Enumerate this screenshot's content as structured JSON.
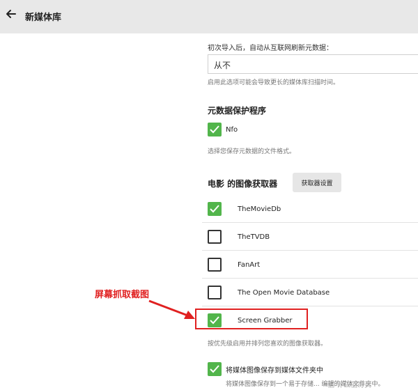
{
  "header": {
    "back_icon": "arrow-left-icon",
    "title": "新媒体库"
  },
  "metadata_download": {
    "label": "初次导入后，自动从互联网刷新元数据：",
    "selected_value": "从不",
    "hint": "启用此选项可能会导致更长的媒体库扫描时间。"
  },
  "metadata_savers": {
    "title": "元数据保护程序",
    "items": [
      {
        "label": "Nfo",
        "checked": true
      }
    ],
    "hint": "选择您保存元数据的文件格式。"
  },
  "image_fetchers": {
    "title": "电影 的图像获取器",
    "settings_button": "获取器设置",
    "items": [
      {
        "label": "TheMovieDb",
        "checked": true
      },
      {
        "label": "TheTVDB",
        "checked": false
      },
      {
        "label": "FanArt",
        "checked": false
      },
      {
        "label": "The Open Movie Database",
        "checked": false
      },
      {
        "label": "Screen Grabber",
        "checked": true
      }
    ],
    "hint": "按优先级启用并排列您喜欢的图像获取器。"
  },
  "save_local": {
    "label": "将媒体图像保存到媒体文件夹中",
    "checked": true,
    "hint": "将媒体图像保存到一个易于存储... 编辑的媒体文件夹中。"
  },
  "annotation": {
    "text": "屏幕抓取截图",
    "color": "#e02020"
  },
  "watermark": "值 什么值得买",
  "colors": {
    "accent_green": "#52b54b",
    "header_bg": "#e8e8e8"
  }
}
